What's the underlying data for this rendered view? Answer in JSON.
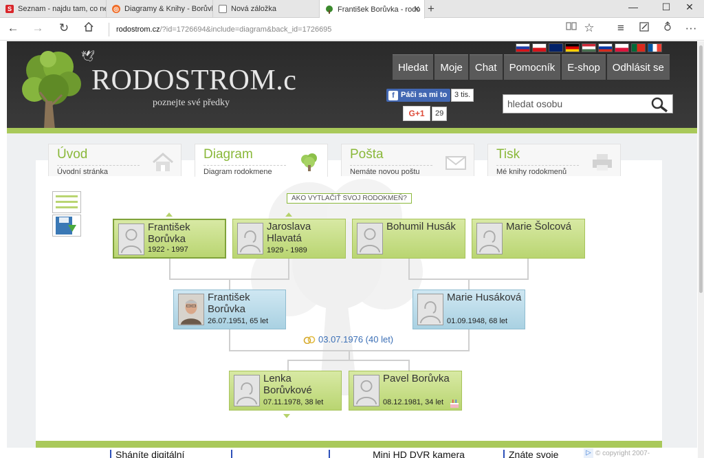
{
  "browser": {
    "tabs": [
      {
        "title": "Seznam - najdu tam, co nez",
        "icon": "seznam-icon"
      },
      {
        "title": "Diagramy & Knihy - Borůvk",
        "icon": "rodostrom-icon"
      },
      {
        "title": "Nová záložka",
        "icon": "newtab-page-icon"
      },
      {
        "title": "František Borůvka - rodo",
        "icon": "tree-favicon"
      }
    ],
    "new_tab": "+",
    "url_host": "rodostrom.cz",
    "url_path": "/?id=1726694&include=diagram&back_id=1726695"
  },
  "site": {
    "logo_text": "RODOSTROM.c",
    "slogan": "poznejte své předky",
    "menu": [
      "Hledat",
      "Moje",
      "Chat",
      "Pomocník",
      "E-shop",
      "Odhlásit se"
    ],
    "fb_like": "Páči sa mi to",
    "fb_count": "3 tis.",
    "gplus": "G+1",
    "gplus_count": "29",
    "search_placeholder": "hledat osobu",
    "flag_colors": [
      "#1e3fa8",
      "#d7141a",
      "#012169",
      "#ffce00",
      "#ce1126",
      "#d52b1e",
      "#dc143c",
      "#046a38",
      "#0055a4"
    ]
  },
  "content_tabs": [
    {
      "title": "Úvod",
      "sub": "Úvodní stránka",
      "icon": "home-icon"
    },
    {
      "title": "Diagram",
      "sub": "Diagram rodokmene",
      "icon": "tree-icon"
    },
    {
      "title": "Pošta",
      "sub": "Nemáte novou poštu",
      "icon": "mail-icon"
    },
    {
      "title": "Tisk",
      "sub": "Mé knihy rodokmenů",
      "icon": "printer-icon"
    }
  ],
  "print_link": "AKO VYTLAČIŤ SVOJ RODOKMEŇ?",
  "grandparents": [
    {
      "name": "František Borůvka",
      "dates": "1922 - 1997"
    },
    {
      "name": "Jaroslava Hlavatá",
      "dates": "1929 - 1989"
    },
    {
      "name": "Bohumil Husák",
      "dates": ""
    },
    {
      "name": "Marie Šolcová",
      "dates": ""
    }
  ],
  "parents": [
    {
      "name": "František Borůvka",
      "dates": "26.07.1951, 65 let"
    },
    {
      "name": "Marie Husáková",
      "dates": "01.09.1948, 68 let"
    }
  ],
  "wedding": "03.07.1976 (40 let)",
  "children": [
    {
      "name": "Lenka Borůvkové",
      "dates": "07.11.1978, 38 let"
    },
    {
      "name": "Pavel Borůvka",
      "dates": "08.12.1981, 34 let"
    }
  ],
  "ads": [
    "Sháníte digitální",
    "Mini HD DVR kamera",
    "Znáte svoje"
  ],
  "copyright": "© copyright 2007-"
}
